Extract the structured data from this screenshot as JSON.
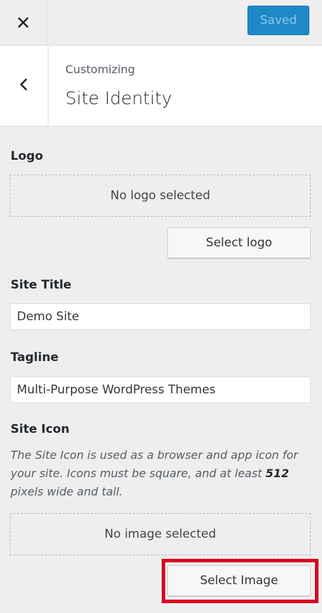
{
  "topbar": {
    "close_icon": "close-icon",
    "saved_label": "Saved",
    "saved_color": "#1f88c7"
  },
  "header": {
    "back_icon": "chevron-left-icon",
    "subtitle": "Customizing",
    "title": "Site Identity"
  },
  "logo": {
    "label": "Logo",
    "placeholder": "No logo selected",
    "button_label": "Select logo"
  },
  "site_title": {
    "label": "Site Title",
    "value": "Demo Site"
  },
  "tagline": {
    "label": "Tagline",
    "value": "Multi-Purpose WordPress Themes"
  },
  "site_icon": {
    "label": "Site Icon",
    "description_part1": "The Site Icon is used as a browser and app icon for your site. Icons must be square, and at least ",
    "description_bold": "512",
    "description_part2": " pixels wide and tall.",
    "placeholder": "No image selected",
    "button_label": "Select Image",
    "highlight_color": "#d9001e"
  }
}
